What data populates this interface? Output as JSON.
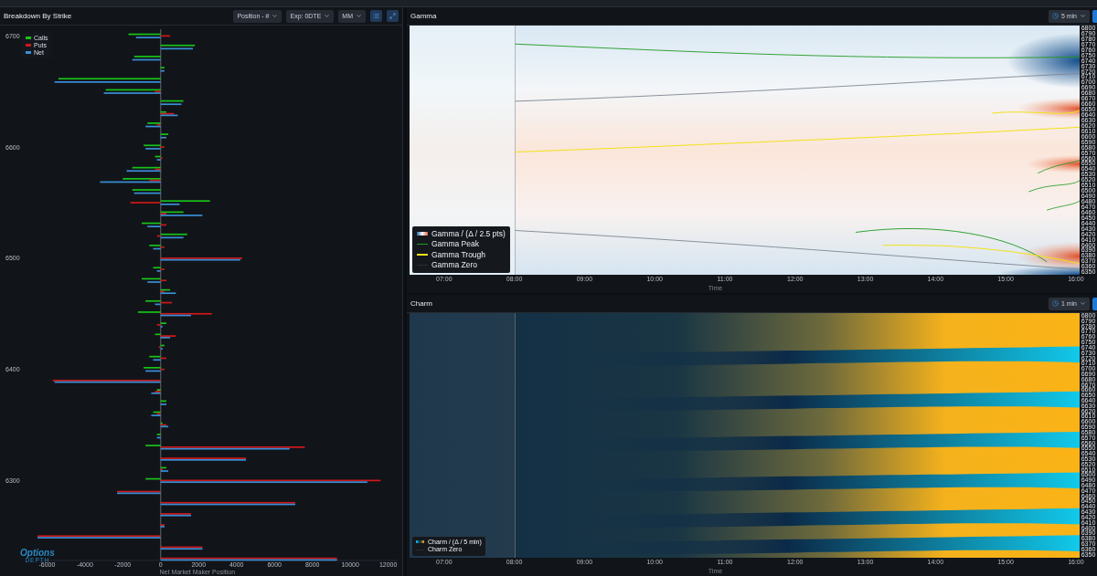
{
  "breakdown": {
    "title": "Breakdown By Strike",
    "controls": [
      "Position - #",
      "Exp: 0DTE",
      "MM"
    ],
    "chart_data": {
      "type": "bar",
      "orientation": "horizontal",
      "xlabel": "Net Market Maker Position",
      "x": [
        6700,
        6690,
        6680,
        6670,
        6660,
        6650,
        6640,
        6630,
        6620,
        6610,
        6600,
        6590,
        6580,
        6570,
        6560,
        6550,
        6540,
        6530,
        6520,
        6510,
        6500,
        6490,
        6480,
        6470,
        6460,
        6450,
        6440,
        6430,
        6420,
        6410,
        6400,
        6390,
        6380,
        6370,
        6360,
        6350,
        6340,
        6330,
        6320,
        6310,
        6300,
        6290,
        6280,
        6270,
        6260,
        6250,
        6240,
        6230
      ],
      "series": [
        {
          "name": "Calls",
          "color": "#18c418",
          "values": [
            -1700,
            1800,
            -1400,
            200,
            -5400,
            -2900,
            1200,
            300,
            -700,
            400,
            -900,
            -300,
            -1500,
            -2000,
            -1500,
            2600,
            1200,
            -1000,
            1400,
            -600,
            0,
            -400,
            -1000,
            500,
            -800,
            -1200,
            300,
            -300,
            200,
            -600,
            -900,
            0,
            -200,
            300,
            -400,
            100,
            -200,
            -800,
            0,
            300,
            -800,
            0,
            0,
            0,
            0,
            0,
            null,
            0
          ]
        },
        {
          "name": "Puts",
          "color": "#d01818",
          "values": [
            500,
            0,
            0,
            0,
            0,
            -300,
            null,
            700,
            -200,
            0,
            200,
            100,
            -300,
            -600,
            0,
            -1600,
            300,
            300,
            -200,
            200,
            4300,
            200,
            300,
            200,
            600,
            2700,
            -200,
            800,
            -100,
            300,
            200,
            -5700,
            -300,
            0,
            -200,
            300,
            0,
            7600,
            4500,
            100,
            11600,
            -2300,
            7100,
            1600,
            200,
            -6500,
            2200,
            9300
          ]
        },
        {
          "name": "Net",
          "color": "#3a8fd8",
          "values": [
            -1300,
            1700,
            -1500,
            200,
            -5600,
            -3000,
            1100,
            900,
            -800,
            300,
            -800,
            -200,
            -1800,
            -3200,
            -1400,
            1000,
            2200,
            -700,
            1200,
            -400,
            4200,
            -200,
            -700,
            800,
            -300,
            1600,
            100,
            500,
            100,
            -400,
            -800,
            -5600,
            -500,
            300,
            -500,
            400,
            -200,
            6800,
            4500,
            400,
            10900,
            -2300,
            7100,
            1600,
            200,
            -6500,
            2200,
            9300
          ]
        }
      ],
      "xlim": [
        -6500,
        12500
      ],
      "xticks": [
        -6000,
        -4000,
        -2000,
        0,
        2000,
        4000,
        6000,
        8000,
        10000,
        12000
      ],
      "ylim": [
        6228,
        6706
      ],
      "yticks": [
        6700,
        6600,
        6500,
        6400,
        6300
      ]
    },
    "logo": {
      "name": "Options",
      "tagline": "DEPTH"
    }
  },
  "gamma": {
    "title": "Gamma",
    "interval": "5 min",
    "legend": [
      {
        "kind": "gradient",
        "label": "Gamma / (Δ / 2.5 pts)"
      },
      {
        "kind": "line",
        "label": "Gamma Peak",
        "color": "#1f9a1f"
      },
      {
        "kind": "line",
        "label": "Gamma Trough",
        "color": "#f2e21a"
      },
      {
        "kind": "line",
        "label": "Gamma Zero",
        "color": "#2a2f36"
      }
    ],
    "strike_labels": [
      "6800",
      "6790",
      "6780",
      "6770",
      "6760",
      "6750",
      "6740",
      "6730",
      "6720",
      "6710",
      "6700",
      "6690",
      "6680",
      "6670",
      "6660",
      "6650",
      "6640",
      "6630",
      "6620",
      "6610",
      "6600",
      "6590",
      "6580",
      "6570",
      "6560",
      "6550",
      "6540",
      "6530",
      "6520",
      "6510",
      "6500",
      "6490",
      "6480",
      "6470",
      "6460",
      "6450",
      "6440",
      "6430",
      "6420",
      "6410",
      "6400",
      "6390",
      "6380",
      "6370",
      "6360",
      "6350"
    ],
    "time_ticks": [
      "07:00",
      "08:00",
      "09:00",
      "10:00",
      "11:00",
      "12:00",
      "13:00",
      "14:00",
      "15:00",
      "16:00"
    ],
    "time_label": "Time"
  },
  "charm": {
    "title": "Charm",
    "interval": "1 min",
    "legend": [
      {
        "kind": "gradient",
        "label": "Charm / (Δ / 5 min)"
      },
      {
        "kind": "line",
        "label": "Charm Zero",
        "color": "#2a2f36"
      }
    ],
    "strike_labels": [
      "6800",
      "6790",
      "6780",
      "6770",
      "6760",
      "6750",
      "6740",
      "6730",
      "6720",
      "6710",
      "6700",
      "6690",
      "6680",
      "6670",
      "6660",
      "6650",
      "6640",
      "6630",
      "6620",
      "6610",
      "6600",
      "6590",
      "6580",
      "6570",
      "6560",
      "6550",
      "6540",
      "6530",
      "6520",
      "6510",
      "6500",
      "6490",
      "6480",
      "6470",
      "6460",
      "6450",
      "6440",
      "6430",
      "6420",
      "6410",
      "6400",
      "6390",
      "6380",
      "6370",
      "6360",
      "6350"
    ],
    "time_ticks": [
      "07:00",
      "08:00",
      "09:00",
      "10:00",
      "11:00",
      "12:00",
      "13:00",
      "14:00",
      "15:00",
      "16:00"
    ],
    "time_label": "Time"
  }
}
